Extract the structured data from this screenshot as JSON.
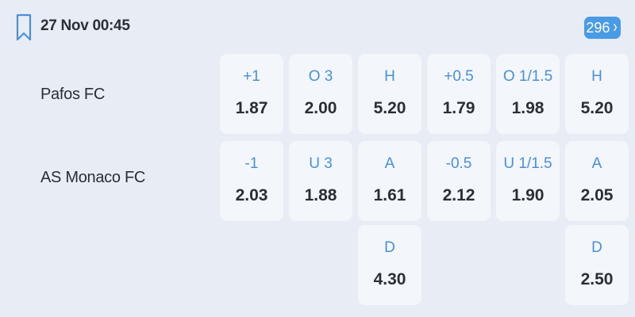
{
  "match": {
    "datetime": "27 Nov 00:45",
    "more_count": "296",
    "home_team": "Pafos FC",
    "away_team": "AS Monaco FC"
  },
  "markets": {
    "home_row": [
      {
        "label": "+1",
        "odds": "1.87"
      },
      {
        "label": "O 3",
        "odds": "2.00"
      },
      {
        "label": "H",
        "odds": "5.20"
      },
      {
        "label": "+0.5",
        "odds": "1.79"
      },
      {
        "label": "O 1/1.5",
        "odds": "1.98"
      },
      {
        "label": "H",
        "odds": "5.20"
      }
    ],
    "away_row": [
      {
        "label": "-1",
        "odds": "2.03"
      },
      {
        "label": "U 3",
        "odds": "1.88"
      },
      {
        "label": "A",
        "odds": "1.61"
      },
      {
        "label": "-0.5",
        "odds": "2.12"
      },
      {
        "label": "U 1/1.5",
        "odds": "1.90"
      },
      {
        "label": "A",
        "odds": "2.05"
      }
    ],
    "draw_row": [
      {
        "label": "D",
        "odds": "4.30"
      },
      {
        "label": "D",
        "odds": "2.50"
      }
    ]
  },
  "icons": {
    "bookmark": "bookmark-icon",
    "more": "chevron-right-icon"
  },
  "colors": {
    "background": "#e8edf5",
    "cell": "#f3f6fa",
    "accent": "#4a9be6",
    "label": "#4a90d9",
    "text": "#2a2f36"
  }
}
